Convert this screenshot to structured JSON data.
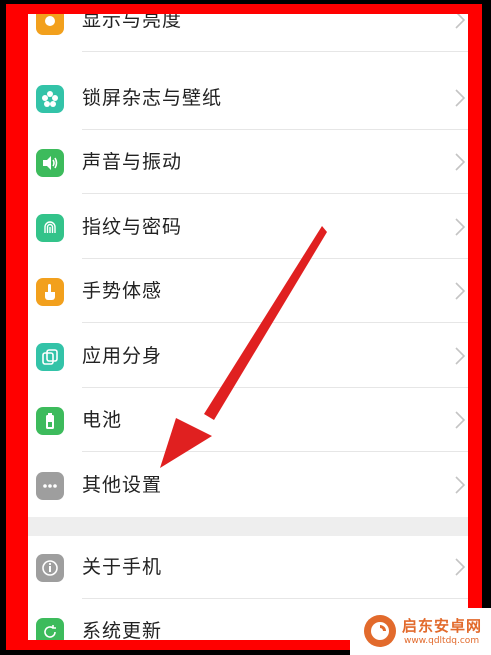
{
  "settings": {
    "items": [
      {
        "label": "显示与亮度",
        "icon": "display-brightness-icon",
        "color": "#f2a01d"
      },
      {
        "label": "锁屏杂志与壁纸",
        "icon": "flower-wallpaper-icon",
        "color": "#33c3a8"
      },
      {
        "label": "声音与振动",
        "icon": "speaker-icon",
        "color": "#3dbb5c"
      },
      {
        "label": "指纹与密码",
        "icon": "fingerprint-icon",
        "color": "#33c38a"
      },
      {
        "label": "手势体感",
        "icon": "hand-gesture-icon",
        "color": "#f2a01d"
      },
      {
        "label": "应用分身",
        "icon": "app-clone-icon",
        "color": "#33c3a8"
      },
      {
        "label": "电池",
        "icon": "battery-icon",
        "color": "#3dbb5c"
      },
      {
        "label": "其他设置",
        "icon": "more-dots-icon",
        "color": "#9e9e9e"
      }
    ],
    "items2": [
      {
        "label": "关于手机",
        "icon": "info-icon",
        "color": "#9e9e9e"
      },
      {
        "label": "系统更新",
        "icon": "update-icon",
        "color": "#3dbb5c"
      }
    ]
  },
  "watermark": {
    "title": "启东安卓网",
    "url": "www.qdltdq.com",
    "accent": "#e26a2c"
  },
  "annotation": {
    "frame_color": "#ff0000",
    "arrow_color": "#e02020"
  }
}
